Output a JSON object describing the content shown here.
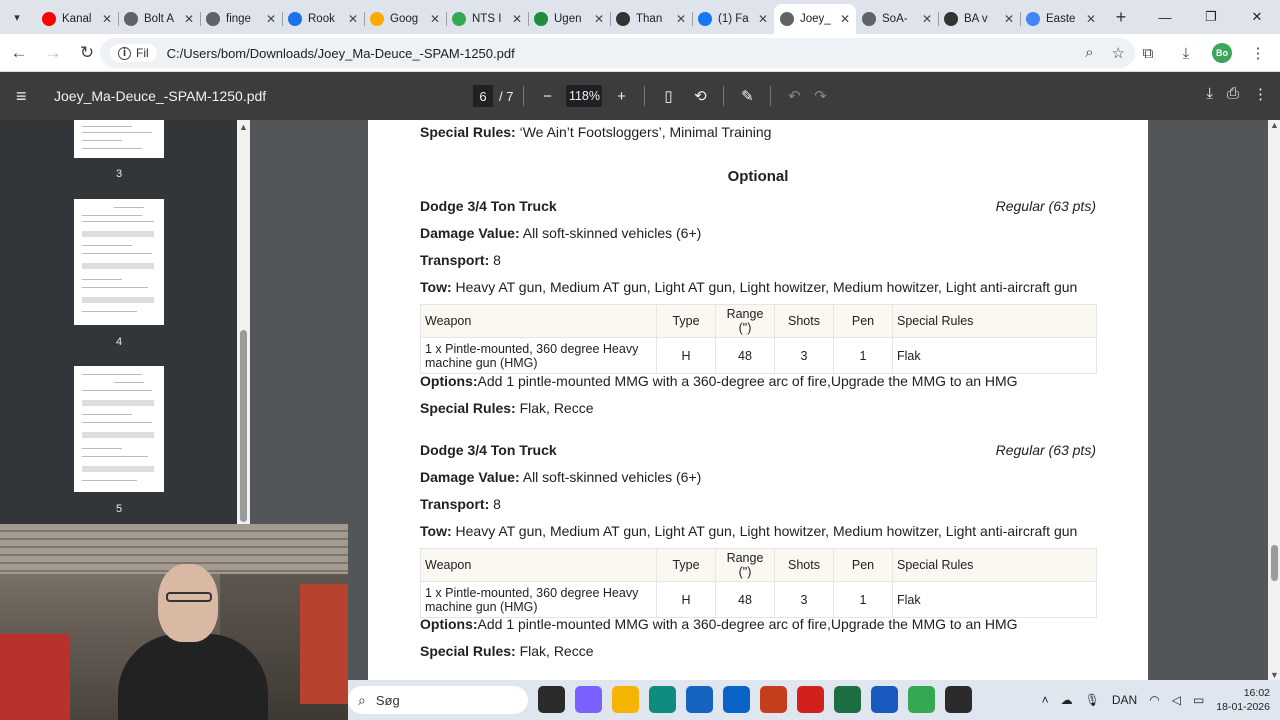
{
  "tabs": [
    {
      "title": "Kanal",
      "color": "#ff0000"
    },
    {
      "title": "Bolt A",
      "color": "#5f6368"
    },
    {
      "title": "finge",
      "color": "#5f6368"
    },
    {
      "title": "Rook",
      "color": "#1a73e8"
    },
    {
      "title": "Goog",
      "color": "#f9ab00"
    },
    {
      "title": "NTS I",
      "color": "#34a853"
    },
    {
      "title": "Ugen",
      "color": "#1e8e3e"
    },
    {
      "title": "Than",
      "color": "#333333"
    },
    {
      "title": "(1) Fa",
      "color": "#1877f2"
    },
    {
      "title": "Joey_",
      "color": "#5f6368"
    },
    {
      "title": "SoA-",
      "color": "#5f6368"
    },
    {
      "title": "BA v",
      "color": "#333333"
    },
    {
      "title": "Easte",
      "color": "#4285f4"
    }
  ],
  "address": {
    "chip": "Fil",
    "url": "C:/Users/bom/Downloads/Joey_Ma-Deuce_-SPAM-1250.pdf"
  },
  "profile_initials": "Bo",
  "pdf": {
    "filename": "Joey_Ma-Deuce_-SPAM-1250.pdf",
    "current_page": "6",
    "total_pages": "/ 7",
    "zoom": "118%"
  },
  "thumbnails": [
    {
      "label": "3"
    },
    {
      "label": "4"
    },
    {
      "label": "5"
    }
  ],
  "page": {
    "top_special_rules_label": "Special Rules:",
    "top_special_rules_value": " ‘We Ain’t Footsloggers’, Minimal Training",
    "section_heading": "Optional",
    "units": [
      {
        "name": "Dodge 3/4 Ton Truck",
        "rating": "Regular (63 pts)",
        "damage_label": "Damage Value:",
        "damage_value": " All soft-skinned vehicles (6+)",
        "transport_label": "Transport:",
        "transport_value": " 8",
        "tow_label": "Tow:",
        "tow_value": " Heavy AT gun, Medium AT gun, Light AT gun, Light howitzer, Medium howitzer, Light anti-aircraft gun",
        "table_headers": [
          "Weapon",
          "Type",
          "Range (\")",
          "Shots",
          "Pen",
          "Special Rules"
        ],
        "weapon": {
          "name": "1 x Pintle-mounted, 360 degree Heavy machine gun (HMG)",
          "type": "H",
          "range": "48",
          "shots": "3",
          "pen": "1",
          "rules": "Flak"
        },
        "options_label": "Options:",
        "options_value": "Add 1 pintle-mounted MMG with a 360-degree arc of fire,Upgrade the MMG to an HMG",
        "special_label": "Special Rules:",
        "special_value": " Flak, Recce"
      },
      {
        "name": "Dodge 3/4 Ton Truck",
        "rating": "Regular (63 pts)",
        "damage_label": "Damage Value:",
        "damage_value": " All soft-skinned vehicles (6+)",
        "transport_label": "Transport:",
        "transport_value": " 8",
        "tow_label": "Tow:",
        "tow_value": " Heavy AT gun, Medium AT gun, Light AT gun, Light howitzer, Medium howitzer, Light anti-aircraft gun",
        "table_headers": [
          "Weapon",
          "Type",
          "Range (\")",
          "Shots",
          "Pen",
          "Special Rules"
        ],
        "weapon": {
          "name": "1 x Pintle-mounted, 360 degree Heavy machine gun (HMG)",
          "type": "H",
          "range": "48",
          "shots": "3",
          "pen": "1",
          "rules": "Flak"
        },
        "options_label": "Options:",
        "options_value": "Add 1 pintle-mounted MMG with a 360-degree arc of fire,Upgrade the MMG to an HMG",
        "special_label": "Special Rules:",
        "special_value": " Flak, Recce"
      }
    ]
  },
  "taskbar": {
    "search_placeholder": "Søg",
    "language": "DAN",
    "time": "16:02",
    "date": "18-01-2026",
    "apps": [
      {
        "name": "task-view",
        "color": "#2b2b2b"
      },
      {
        "name": "copilot",
        "color": "#7b61ff"
      },
      {
        "name": "file-explorer",
        "color": "#f4b400"
      },
      {
        "name": "edge",
        "color": "#0f8c7e"
      },
      {
        "name": "store",
        "color": "#1565c0"
      },
      {
        "name": "outlook",
        "color": "#0a64c8"
      },
      {
        "name": "powerpoint",
        "color": "#c43e1c"
      },
      {
        "name": "acrobat",
        "color": "#d4201c"
      },
      {
        "name": "excel",
        "color": "#1d6f42"
      },
      {
        "name": "word",
        "color": "#185abd"
      },
      {
        "name": "chrome",
        "color": "#34a853"
      },
      {
        "name": "app-dark",
        "color": "#2b2b2b"
      }
    ]
  }
}
